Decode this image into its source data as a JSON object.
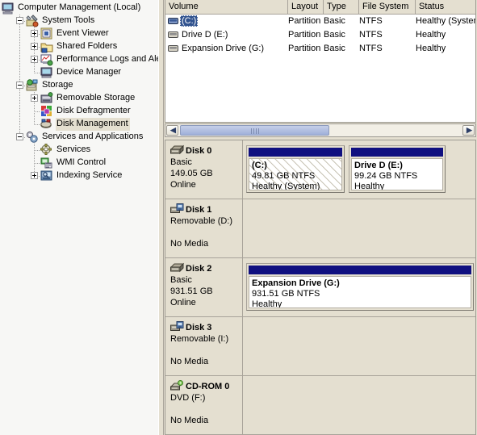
{
  "window": {
    "title": "Computer Management (Local)"
  },
  "sidebar": {
    "root": {
      "label": "Computer Management (Local)",
      "icon": "computer-icon"
    },
    "items": [
      {
        "label": "System Tools",
        "icon": "system-tools-icon",
        "expander": "minus",
        "depth": 1
      },
      {
        "label": "Event Viewer",
        "icon": "event-viewer-icon",
        "expander": "plus",
        "depth": 2
      },
      {
        "label": "Shared Folders",
        "icon": "shared-folders-icon",
        "expander": "plus",
        "depth": 2
      },
      {
        "label": "Performance Logs and Alert:",
        "icon": "performance-logs-icon",
        "expander": "plus",
        "depth": 2
      },
      {
        "label": "Device Manager",
        "icon": "device-manager-icon",
        "expander": "none",
        "depth": 2
      },
      {
        "label": "Storage",
        "icon": "storage-icon",
        "expander": "minus",
        "depth": 1
      },
      {
        "label": "Removable Storage",
        "icon": "removable-storage-icon",
        "expander": "plus",
        "depth": 2
      },
      {
        "label": "Disk Defragmenter",
        "icon": "disk-defragmenter-icon",
        "expander": "none",
        "depth": 2
      },
      {
        "label": "Disk Management",
        "icon": "disk-management-icon",
        "expander": "none",
        "depth": 2,
        "selected": true
      },
      {
        "label": "Services and Applications",
        "icon": "services-apps-icon",
        "expander": "minus",
        "depth": 1
      },
      {
        "label": "Services",
        "icon": "services-icon",
        "expander": "none",
        "depth": 2
      },
      {
        "label": "WMI Control",
        "icon": "wmi-control-icon",
        "expander": "none",
        "depth": 2
      },
      {
        "label": "Indexing Service",
        "icon": "indexing-service-icon",
        "expander": "plus",
        "depth": 2
      }
    ]
  },
  "volume_list": {
    "columns": [
      {
        "key": "volume",
        "label": "Volume"
      },
      {
        "key": "layout",
        "label": "Layout"
      },
      {
        "key": "type",
        "label": "Type"
      },
      {
        "key": "filesystem",
        "label": "File System"
      },
      {
        "key": "status",
        "label": "Status"
      }
    ],
    "rows": [
      {
        "volume": "(C:)",
        "layout": "Partition",
        "type": "Basic",
        "filesystem": "NTFS",
        "status": "Healthy (System)",
        "selected": true,
        "icon": "volume-icon"
      },
      {
        "volume": "Drive D (E:)",
        "layout": "Partition",
        "type": "Basic",
        "filesystem": "NTFS",
        "status": "Healthy",
        "selected": false,
        "icon": "volume-icon"
      },
      {
        "volume": "Expansion Drive (G:)",
        "layout": "Partition",
        "type": "Basic",
        "filesystem": "NTFS",
        "status": "Healthy",
        "selected": false,
        "icon": "volume-icon"
      }
    ]
  },
  "scrollbar": {
    "left_arrow": "◀",
    "right_arrow": "▶"
  },
  "graphical_view": {
    "disks": [
      {
        "name": "Disk 0",
        "icon": "basic-disk-icon",
        "line1": "Basic",
        "line2": "149.05 GB",
        "line3": "Online",
        "partitions": [
          {
            "label": "(C:)",
            "size": "49.81 GB NTFS",
            "status": "Healthy (System)",
            "selected": true,
            "bar_color": "#101080"
          },
          {
            "label": "Drive D  (E:)",
            "size": "99.24 GB NTFS",
            "status": "Healthy",
            "selected": false,
            "bar_color": "#101080"
          }
        ]
      },
      {
        "name": "Disk 1",
        "icon": "removable-disk-icon",
        "line1": "Removable (D:)",
        "line2": "",
        "line3": "No Media",
        "partitions": []
      },
      {
        "name": "Disk 2",
        "icon": "basic-disk-icon",
        "line1": "Basic",
        "line2": "931.51 GB",
        "line3": "Online",
        "partitions": [
          {
            "label": "Expansion Drive  (G:)",
            "size": "931.51 GB NTFS",
            "status": "Healthy",
            "selected": false,
            "bar_color": "#101080"
          }
        ]
      },
      {
        "name": "Disk 3",
        "icon": "removable-disk-icon",
        "line1": "Removable (I:)",
        "line2": "",
        "line3": "No Media",
        "partitions": []
      },
      {
        "name": "CD-ROM 0",
        "icon": "cdrom-icon",
        "line1": "DVD (F:)",
        "line2": "",
        "line3": "No Media",
        "partitions": []
      }
    ]
  },
  "colors": {
    "panel": "#e4dfd0",
    "selection": "#31538f",
    "tree_selection": "#e4dfd0",
    "partition_bar": "#101080",
    "border": "#a8a39a"
  }
}
